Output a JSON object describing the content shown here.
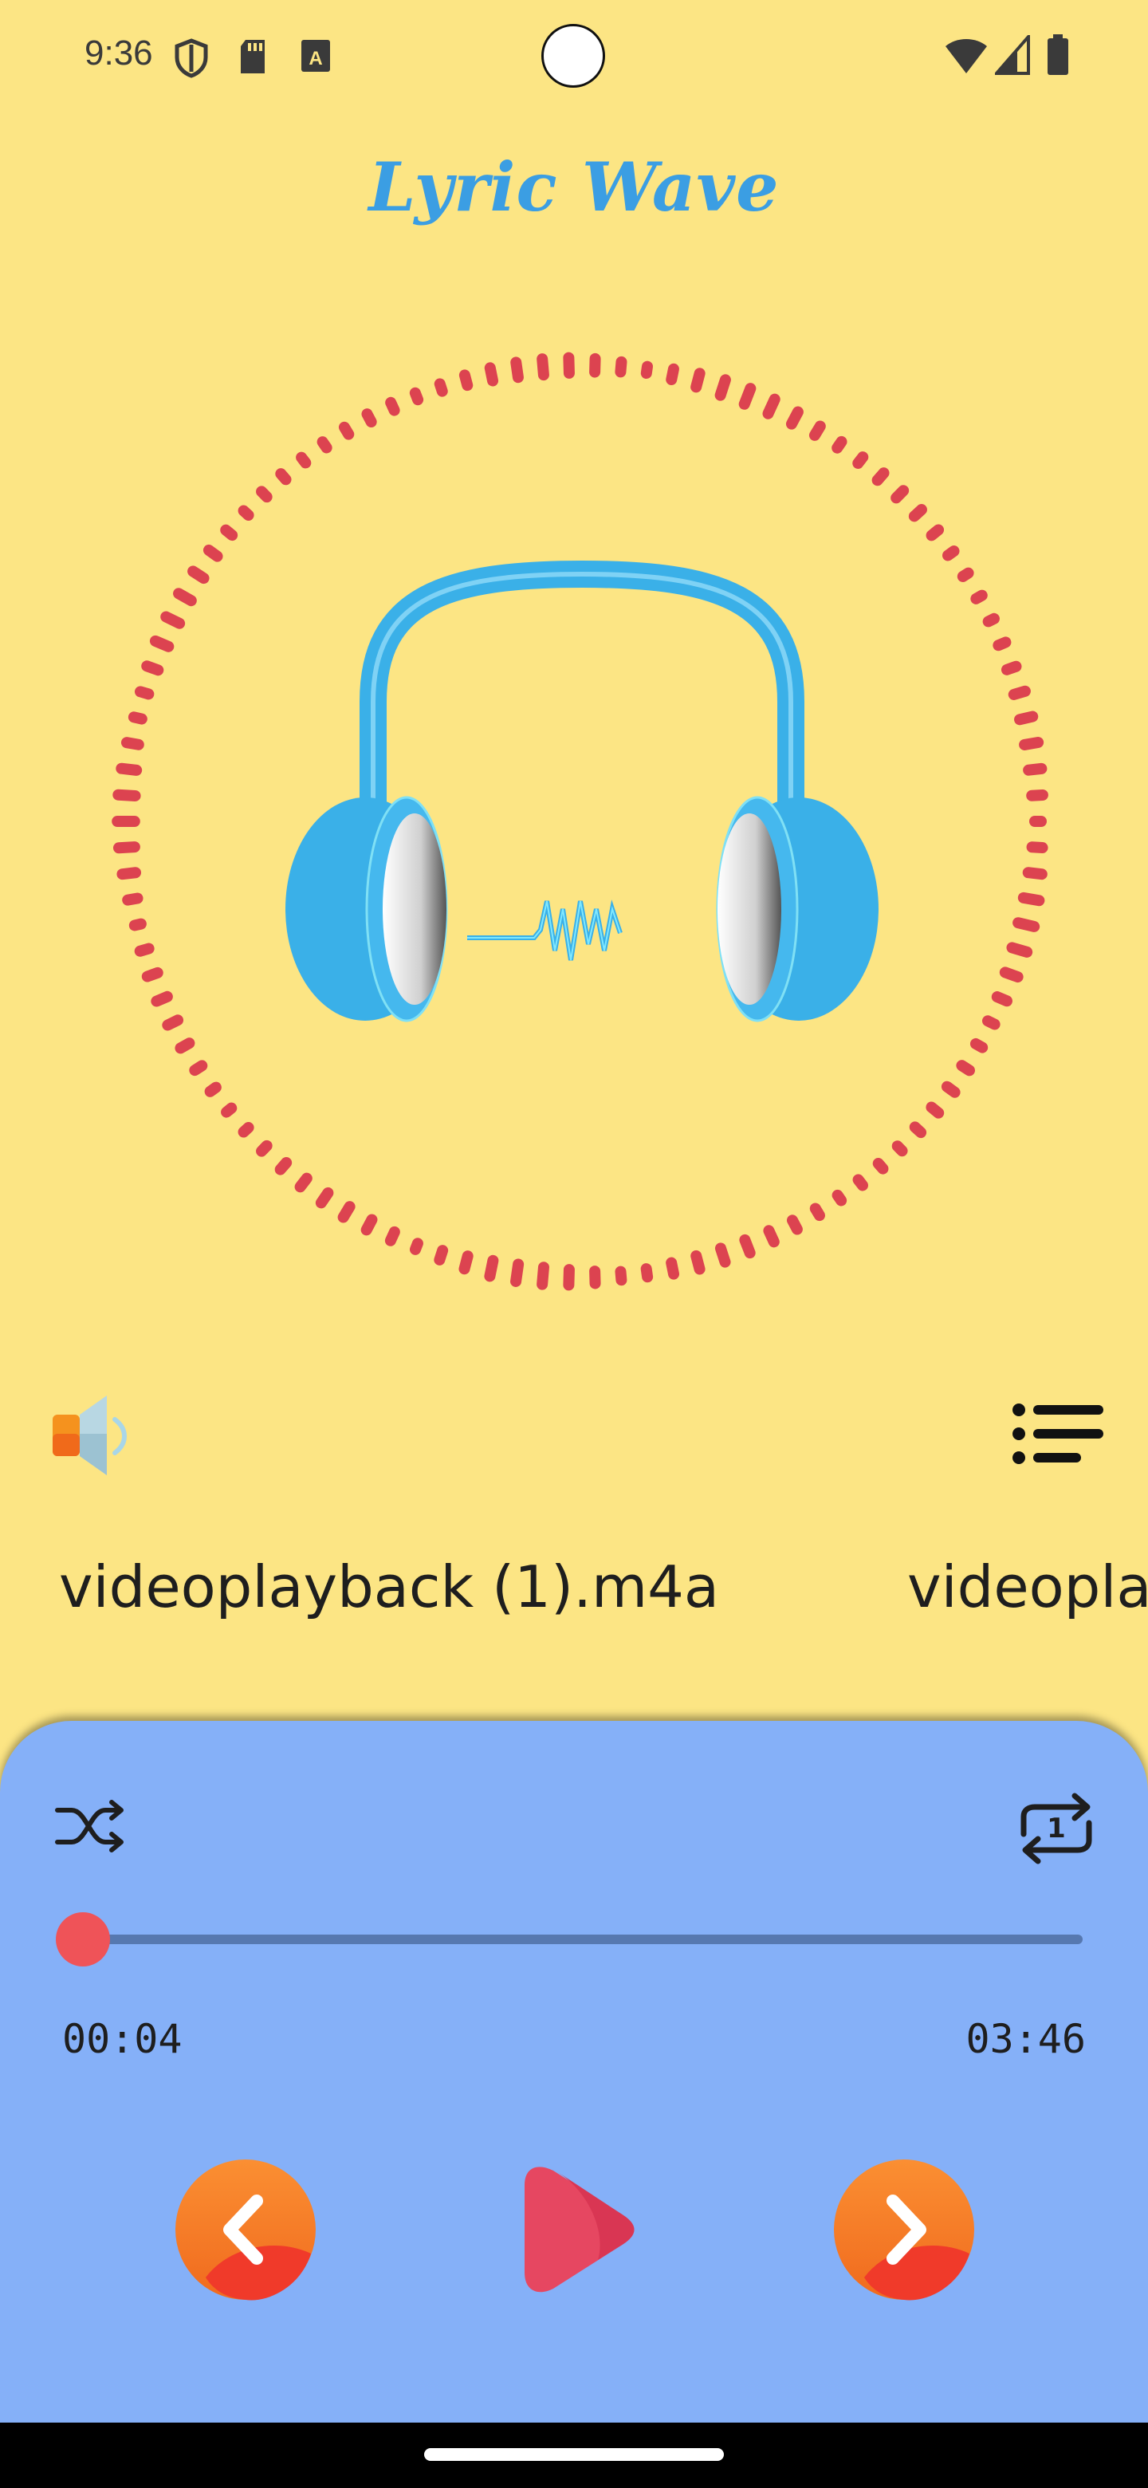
{
  "status_bar": {
    "time": "9:36",
    "left_icons": [
      "shield-icon",
      "sd-card-icon",
      "keyboard-a-icon"
    ],
    "right_icons": [
      "wifi-icon",
      "signal-icon",
      "battery-icon"
    ]
  },
  "app": {
    "title": "Lyric Wave",
    "title_color": "#3b9ee3",
    "background_color": "#fce584"
  },
  "visualizer": {
    "icon": "headphones-icon",
    "ring_color": "#dc4350"
  },
  "controls_row": {
    "volume_icon": "speaker-icon",
    "playlist_icon": "playlist-icon"
  },
  "now_playing": {
    "title": "videoplayback (1).m4a",
    "title_next_partial": "videopla"
  },
  "player": {
    "panel_color": "#85b0f8",
    "shuffle_icon": "shuffle-icon",
    "repeat_icon": "repeat-one-icon",
    "progress_fraction": 0.018,
    "current_time": "00:04",
    "total_time": "03:46",
    "prev_icon": "chevron-left-icon",
    "play_icon": "play-icon",
    "next_icon": "chevron-right-icon",
    "accent_color": "#ef5358"
  }
}
